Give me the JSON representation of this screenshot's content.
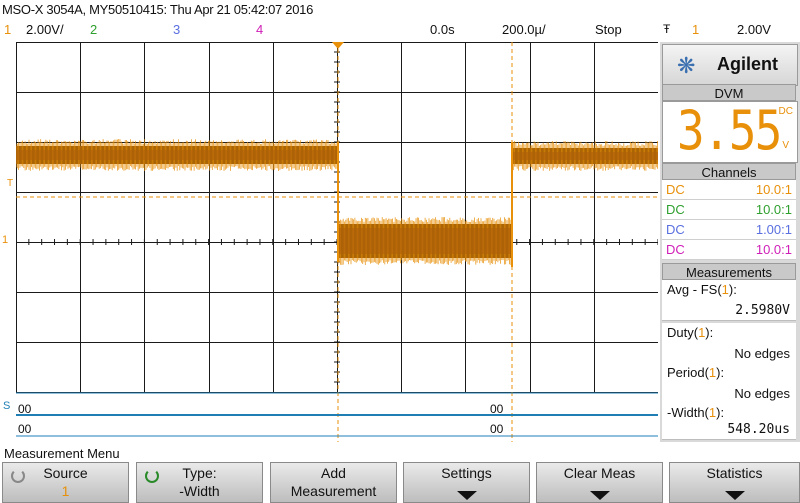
{
  "header": {
    "title": "MSO-X 3054A, MY50510415: Thu Apr 21 05:42:07 2016",
    "ch1_num": "1",
    "ch1_scale": "2.00V/",
    "ch2_num": "2",
    "ch3_num": "3",
    "ch4_num": "4",
    "time_delay": "0.0s",
    "time_scale": "200.0µ/",
    "run_state": "Stop",
    "trigger_symbol": "Ŧ",
    "trigger_channel": "1",
    "trigger_level": "2.00V"
  },
  "colors": {
    "ch1": "#e8900a",
    "ch2": "#2ea02e",
    "ch3": "#5a6fe0",
    "ch4": "#d01fb8",
    "digital": "#1f7fb5",
    "grid": "#1a1a1a"
  },
  "display": {
    "ch1_marker": "1",
    "trig_marker": "T",
    "bus_marker": "S",
    "bus_row1_left": "00",
    "bus_row1_right": "00",
    "bus_row2_left": "00",
    "bus_row2_right": "00"
  },
  "panel": {
    "brand": "Agilent",
    "dvm_header": "DVM",
    "dvm_value": "3.55",
    "dvm_mode": "DC",
    "dvm_unit": "V",
    "channels_header": "Channels",
    "channels": [
      {
        "coupling": "DC",
        "probe": "10.0:1",
        "color": "#e8900a"
      },
      {
        "coupling": "DC",
        "probe": "10.0:1",
        "color": "#2ea02e"
      },
      {
        "coupling": "DC",
        "probe": "1.00:1",
        "color": "#5a6fe0"
      },
      {
        "coupling": "DC",
        "probe": "10.0:1",
        "color": "#d01fb8"
      }
    ],
    "measurements_header": "Measurements",
    "measurements": [
      {
        "label_pre": "Avg - FS(",
        "ch": "1",
        "label_post": "):",
        "value": "2.5980V"
      },
      {
        "label_pre": "Duty(",
        "ch": "1",
        "label_post": "):",
        "value": "No edges"
      },
      {
        "label_pre": "Period(",
        "ch": "1",
        "label_post": "):",
        "value": "No edges"
      },
      {
        "label_pre": "-Width(",
        "ch": "1",
        "label_post": "):",
        "value": "548.20us"
      }
    ]
  },
  "menu": {
    "title": "Measurement Menu",
    "softkeys": [
      {
        "line1": "Source",
        "line2": "1"
      },
      {
        "line1": "Type:",
        "line2": "-Width"
      },
      {
        "line1": "Add",
        "line2": "Measurement"
      },
      {
        "line1": "Settings",
        "line2": ""
      },
      {
        "line1": "Clear Meas",
        "line2": ""
      },
      {
        "line1": "Statistics",
        "line2": ""
      }
    ]
  }
}
